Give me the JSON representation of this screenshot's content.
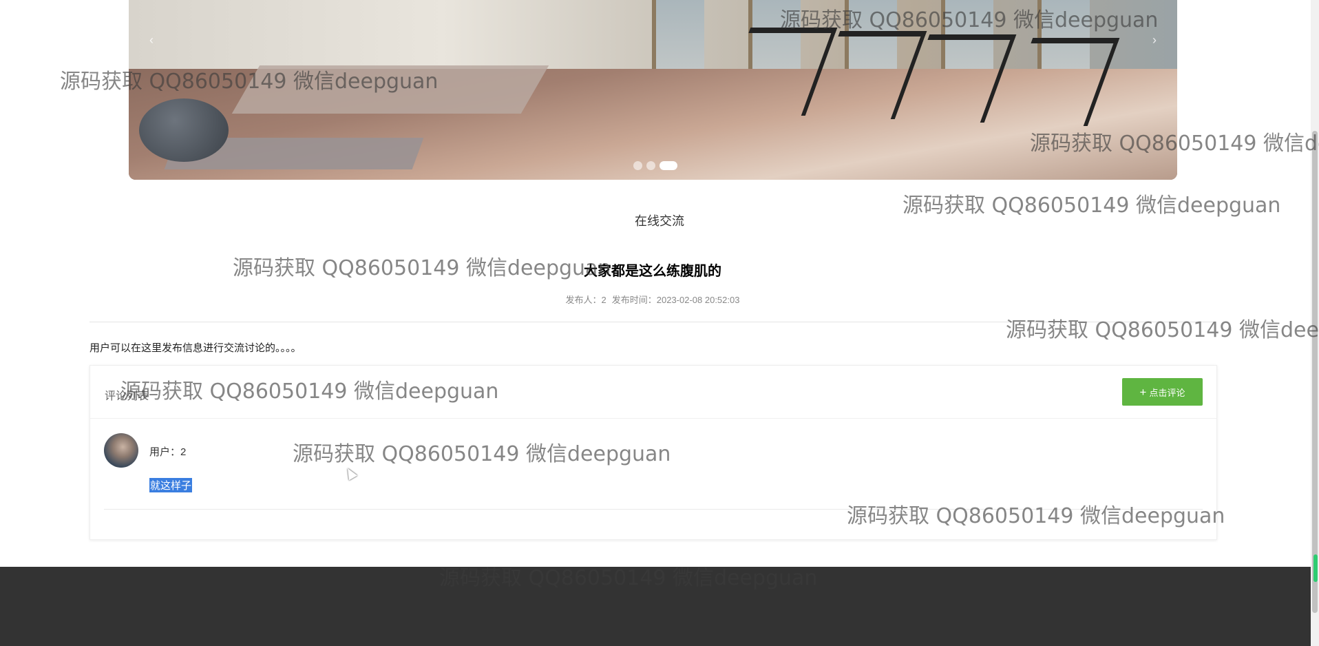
{
  "banner": {
    "slides_count": 3,
    "active_slide": 3,
    "prev_arrow": "‹",
    "next_arrow": "›"
  },
  "section": {
    "title": "在线交流"
  },
  "post": {
    "title": "大家都是这么练腹肌的",
    "publisher_label": "发布人：2",
    "publish_time_label": "发布时间：2023-02-08 20:52:03",
    "body": "用户可以在这里发布信息进行交流讨论的。。。。"
  },
  "comments": {
    "header": "评论列表",
    "add_button_icon": "+",
    "add_button_label": "点击评论",
    "button_color": "#5fb541",
    "items": [
      {
        "user": "用户：2",
        "text": "就这样子"
      }
    ]
  },
  "footer": {
    "color": "#333333"
  },
  "watermarks": [
    "源码获取 QQ86050149 微信deepguan",
    "源码获取 QQ86050149 微信deepguan",
    "源码获取 QQ86050149 微信de",
    "源码获取 QQ86050149 微信deepguan",
    "源码获取 QQ86050149 微信deepguan",
    "源码获取 QQ86050149 微信deep",
    "源码获取 QQ86050149 微信deepguan",
    "源码获取 QQ86050149 微信deepguan",
    "源码获取 QQ86050149 微信deepguan",
    "源码获取 QQ86050149 微信deepguan"
  ]
}
